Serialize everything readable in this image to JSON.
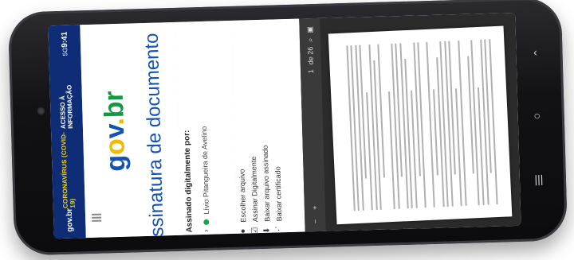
{
  "status_bar": {
    "time": "9:41",
    "brand": "gov.br",
    "banner": "CORONAVÍRUS (COVID-19)",
    "access": "ACESSO À INFORMAÇÃO",
    "signal": "5G"
  },
  "header": {
    "logo": {
      "g": "g",
      "o": "o",
      "v": "v",
      "dot": ".",
      "b": "br"
    },
    "title": "Assinatura de documento"
  },
  "signed": {
    "label": "Assinado digitalmente por:",
    "signer": "Lívio Pitangueira de Avelino"
  },
  "actions": [
    {
      "label": "Escolher arquivo",
      "icon": "circle-icon"
    },
    {
      "label": "Assinar Digitalmente",
      "icon": "check-square-icon"
    },
    {
      "label": "Baixar arquivo assinado",
      "icon": "download-icon"
    },
    {
      "label": "Baixar certificado",
      "icon": "share-icon"
    }
  ],
  "viewer": {
    "page_current": "1",
    "page_total": "de 26",
    "zoom_in": "+",
    "zoom_out": "−"
  },
  "colors": {
    "navy": "#0f2d77",
    "blue": "#1351b4",
    "yellow": "#f2b900",
    "green": "#0f9b42"
  }
}
